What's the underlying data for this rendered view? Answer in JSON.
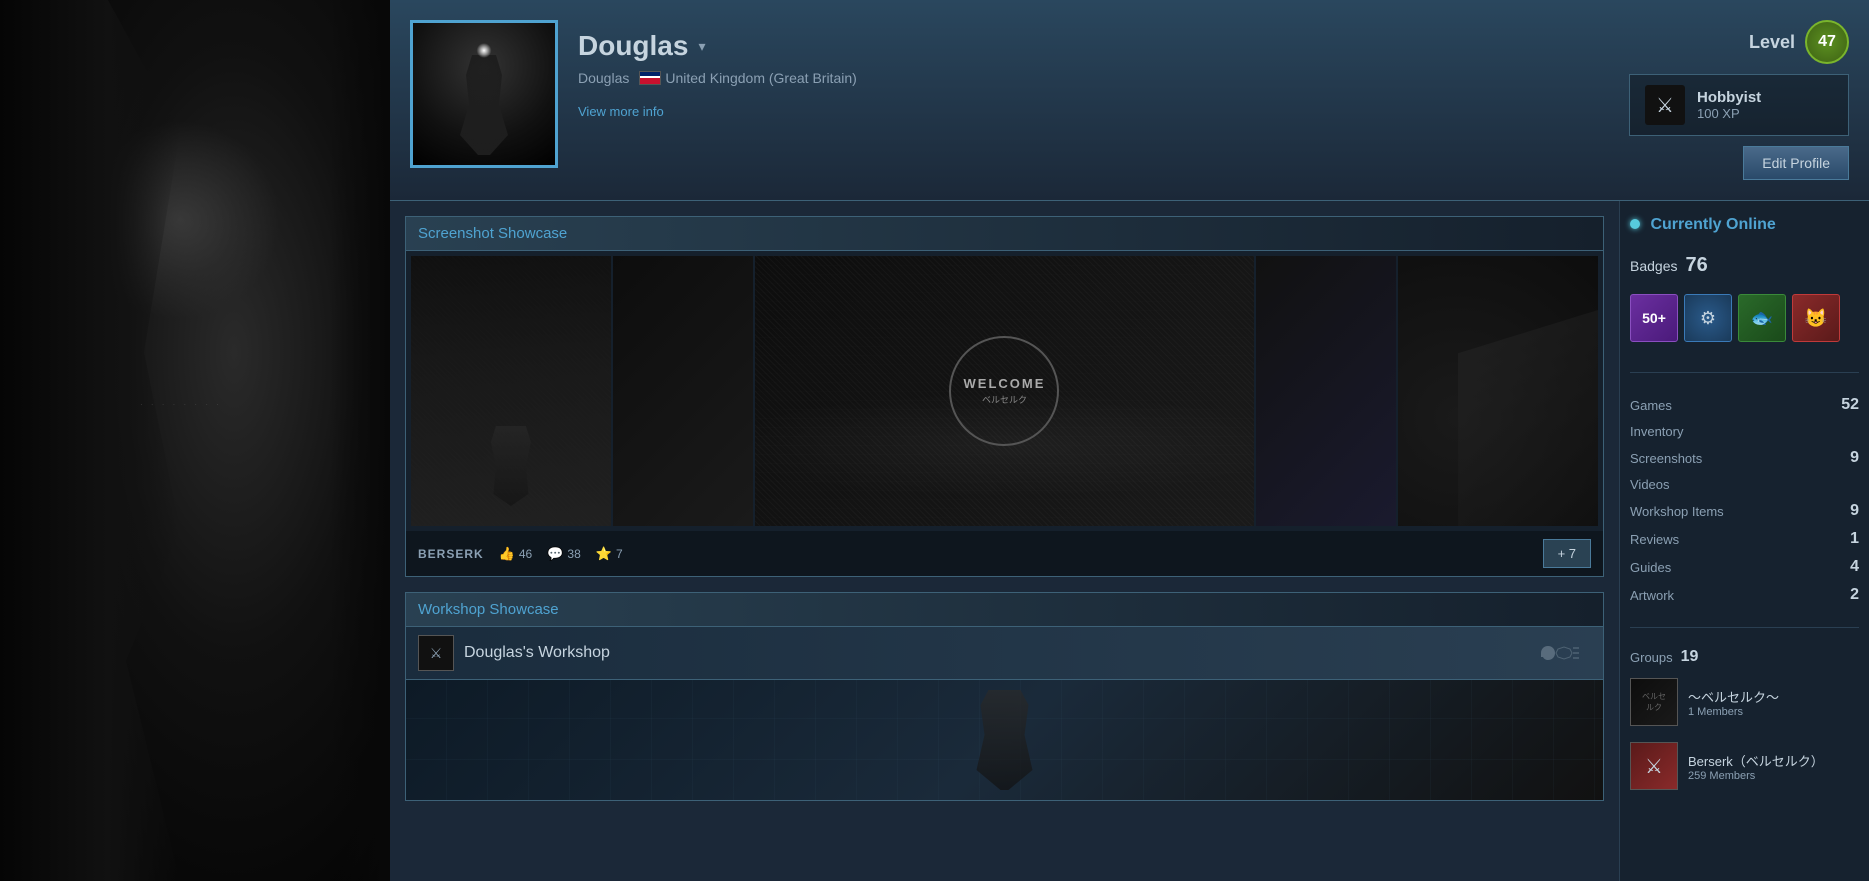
{
  "background": {
    "art_description": "dark wolf moon artwork"
  },
  "profile": {
    "name": "Douglas",
    "subname": "Douglas",
    "country": "United Kingdom (Great Britain)",
    "view_more_label": "View more info",
    "level_label": "Level",
    "level_value": "47",
    "hobbyist_title": "Hobbyist",
    "hobbyist_xp": "100 XP",
    "edit_profile_label": "Edit Profile"
  },
  "status": {
    "label": "Currently Online"
  },
  "badges": {
    "label": "Badges",
    "count": "76",
    "items": [
      {
        "type": "50plus",
        "label": "50+"
      },
      {
        "type": "gear",
        "label": "⚙"
      },
      {
        "type": "green",
        "label": "🐟"
      },
      {
        "type": "red",
        "label": "😺"
      }
    ]
  },
  "stats": {
    "games": {
      "label": "Games",
      "value": "52"
    },
    "inventory": {
      "label": "Inventory",
      "value": ""
    },
    "screenshots": {
      "label": "Screenshots",
      "value": "9"
    },
    "videos": {
      "label": "Videos",
      "value": ""
    },
    "workshop_items": {
      "label": "Workshop Items",
      "value": "9"
    },
    "reviews": {
      "label": "Reviews",
      "value": "1"
    },
    "guides": {
      "label": "Guides",
      "value": "4"
    },
    "artwork": {
      "label": "Artwork",
      "value": "2"
    }
  },
  "groups": {
    "label": "Groups",
    "count": "19",
    "items": [
      {
        "name": "～ベルセルク～",
        "members": "1 Members",
        "avatar_type": "berserk"
      },
      {
        "name": "Berserk（ベルセルク）",
        "members": "259 Members",
        "avatar_type": "red"
      }
    ]
  },
  "screenshot_showcase": {
    "title": "Screenshot Showcase",
    "game_name": "BERSERK",
    "stats": {
      "likes": "46",
      "comments": "38",
      "stars": "7"
    },
    "more_label": "+ 7"
  },
  "workshop_showcase": {
    "title": "Workshop Showcase",
    "workshop_name": "Douglas's Workshop"
  }
}
